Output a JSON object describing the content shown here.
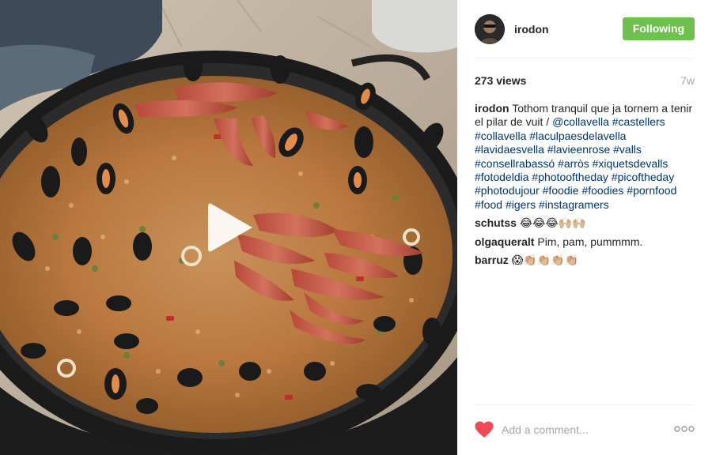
{
  "post": {
    "username": "irodon",
    "follow_label": "Following",
    "views": "273 views",
    "time": "7w"
  },
  "caption": {
    "author": "irodon",
    "segments": [
      {
        "text": "Tothom tranquil que ja tornem a tenir el pilar de vuit / ",
        "link": false
      },
      {
        "text": "@collavella",
        "link": true
      },
      {
        "text": " ",
        "link": false
      },
      {
        "text": "#castellers",
        "link": true
      },
      {
        "text": " ",
        "link": false
      },
      {
        "text": "#collavella",
        "link": true
      },
      {
        "text": " ",
        "link": false
      },
      {
        "text": "#laculpaesdelavella",
        "link": true
      },
      {
        "text": " ",
        "link": false
      },
      {
        "text": "#lavidaesvella",
        "link": true
      },
      {
        "text": " ",
        "link": false
      },
      {
        "text": "#lavieenrose",
        "link": true
      },
      {
        "text": " ",
        "link": false
      },
      {
        "text": "#valls",
        "link": true
      },
      {
        "text": " ",
        "link": false
      },
      {
        "text": "#consellrabassó",
        "link": true
      },
      {
        "text": " ",
        "link": false
      },
      {
        "text": "#arròs",
        "link": true
      },
      {
        "text": " ",
        "link": false
      },
      {
        "text": "#xiquetsdevalls",
        "link": true
      },
      {
        "text": " ",
        "link": false
      },
      {
        "text": "#fotodeldia",
        "link": true
      },
      {
        "text": " ",
        "link": false
      },
      {
        "text": "#photooftheday",
        "link": true
      },
      {
        "text": " ",
        "link": false
      },
      {
        "text": "#picoftheday",
        "link": true
      },
      {
        "text": " ",
        "link": false
      },
      {
        "text": "#photodujour",
        "link": true
      },
      {
        "text": " ",
        "link": false
      },
      {
        "text": "#foodie",
        "link": true
      },
      {
        "text": " ",
        "link": false
      },
      {
        "text": "#foodies",
        "link": true
      },
      {
        "text": " ",
        "link": false
      },
      {
        "text": "#pornfood",
        "link": true
      },
      {
        "text": " ",
        "link": false
      },
      {
        "text": "#food",
        "link": true
      },
      {
        "text": " ",
        "link": false
      },
      {
        "text": "#igers",
        "link": true
      },
      {
        "text": " ",
        "link": false
      },
      {
        "text": "#instagramers",
        "link": true
      }
    ]
  },
  "comments": [
    {
      "author": "schutss",
      "text": "😂😂😂🙌🏼🙌🏼"
    },
    {
      "author": "olgaqueralt",
      "text": "Pim, pam, pummmm."
    },
    {
      "author": "barruz",
      "text": "😱👏🏼👏🏼👏🏼👏🏼"
    }
  ],
  "footer": {
    "comment_placeholder": "Add a comment...",
    "like_icon": "heart-icon",
    "more_icon": "more-options-icon"
  },
  "media": {
    "type": "video",
    "play_icon": "play-icon"
  },
  "colors": {
    "follow_button": "#70c050",
    "link": "#003569",
    "muted": "#a5a7aa",
    "heart": "#ed4956"
  }
}
